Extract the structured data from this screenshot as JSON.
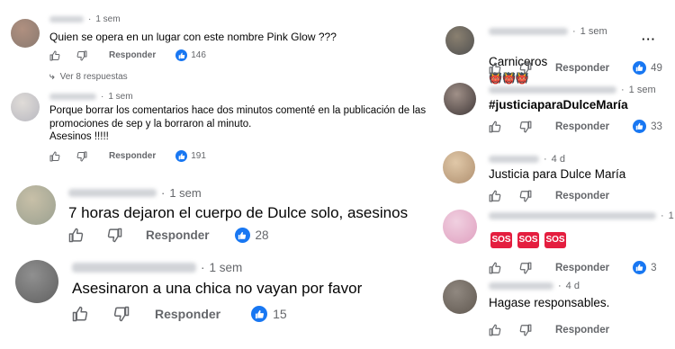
{
  "common": {
    "reply_label": "Responder",
    "sep": "·"
  },
  "left": [
    {
      "time": "1 sem",
      "text": "Quien se opera en un lugar con este nombre Pink Glow ???",
      "likes": "146",
      "replies_link": "Ver 8 respuestas",
      "avatar_colors": [
        "#8a7a70",
        "#b09080"
      ]
    },
    {
      "time": "1 sem",
      "text": "Porque borrar los comentarios hace dos minutos comenté en la publicación de las\npromociones de sep y la borraron al minuto.\nAsesinos !!!!!",
      "likes": "191",
      "avatar_colors": [
        "#b8b8c0",
        "#e0dcd8"
      ]
    },
    {
      "time": "1 sem",
      "text": "7 horas dejaron el cuerpo de Dulce solo, asesinos",
      "likes": "28",
      "avatar_colors": [
        "#9aa090",
        "#c8c0a8"
      ]
    },
    {
      "time": "1 sem",
      "text": "Asesinaron a una chica no vayan por favor",
      "likes": "15",
      "avatar_colors": [
        "#606060",
        "#909090"
      ]
    }
  ],
  "right": [
    {
      "time": "1 sem",
      "text": "Carniceros",
      "emoji": "👹👹👹",
      "likes": "49",
      "more_label": "···",
      "avatar_colors": [
        "#505050",
        "#8a8070"
      ]
    },
    {
      "time": "1 sem",
      "text": "#justiciaparaDulceMaría",
      "likes": "33",
      "avatar_colors": [
        "#403838",
        "#a09088"
      ]
    },
    {
      "time": "4 d",
      "text": "Justicia para Dulce María",
      "likes": "",
      "avatar_colors": [
        "#b09070",
        "#e0c8a8"
      ]
    },
    {
      "time": "1",
      "text": "",
      "sos": [
        "SOS",
        "SOS",
        "SOS"
      ],
      "likes": "3",
      "avatar_colors": [
        "#e0a0c0",
        "#f0d0e0"
      ]
    },
    {
      "time": "4 d",
      "text": "Hagase responsables.",
      "likes": "",
      "avatar_colors": [
        "#605850",
        "#908880"
      ]
    }
  ],
  "colors": {
    "meta": "#65676b",
    "like_blue": "#1877f2",
    "sos_red": "#e41e3f"
  }
}
